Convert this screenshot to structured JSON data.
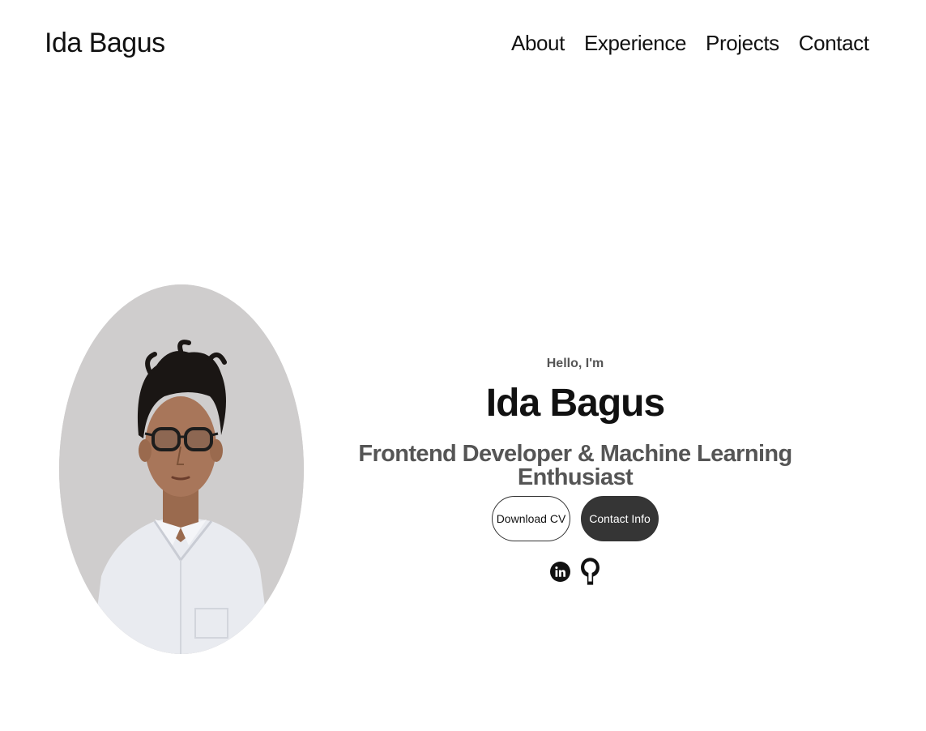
{
  "nav": {
    "logo": "Ida Bagus",
    "links": [
      {
        "label": "About"
      },
      {
        "label": "Experience"
      },
      {
        "label": "Projects"
      },
      {
        "label": "Contact"
      }
    ]
  },
  "hero": {
    "greeting": "Hello, I'm",
    "name": "Ida Bagus",
    "title": "Frontend Developer & Machine Learning Enthusiast",
    "buttons": {
      "download_cv": "Download CV",
      "contact_info": "Contact Info"
    },
    "social": [
      {
        "icon": "linkedin-icon"
      },
      {
        "icon": "github-icon"
      }
    ],
    "photo": {
      "icon": "profile-photo"
    }
  },
  "colors": {
    "text": "#111111",
    "muted": "#555555",
    "button_dark": "#353535",
    "photo_bg": "#cfcdcd"
  }
}
